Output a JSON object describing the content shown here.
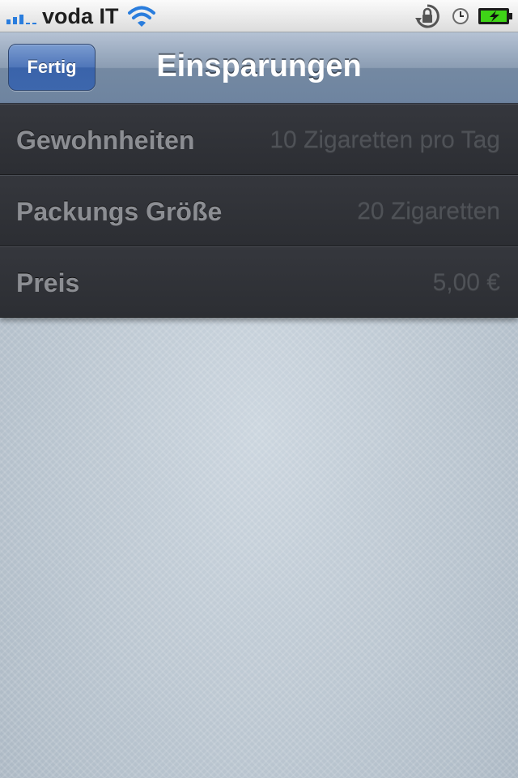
{
  "status_bar": {
    "carrier": "voda IT",
    "icons": [
      "signal-bars",
      "wifi-icon",
      "rotation-lock-icon",
      "alarm-clock-icon",
      "battery-charging-icon"
    ],
    "battery_color": "#3fd317",
    "signal_color": "#2a7ddd"
  },
  "nav_bar": {
    "done_button_label": "Fertig",
    "title": "Einsparungen",
    "tint_color": "#7489a2"
  },
  "settings": {
    "rows": [
      {
        "label": "Gewohnheiten",
        "value": "10 Zigaretten pro Tag"
      },
      {
        "label": "Packungs Größe",
        "value": "20 Zigaretten"
      },
      {
        "label": "Preis",
        "value": "5,00 €"
      }
    ]
  }
}
